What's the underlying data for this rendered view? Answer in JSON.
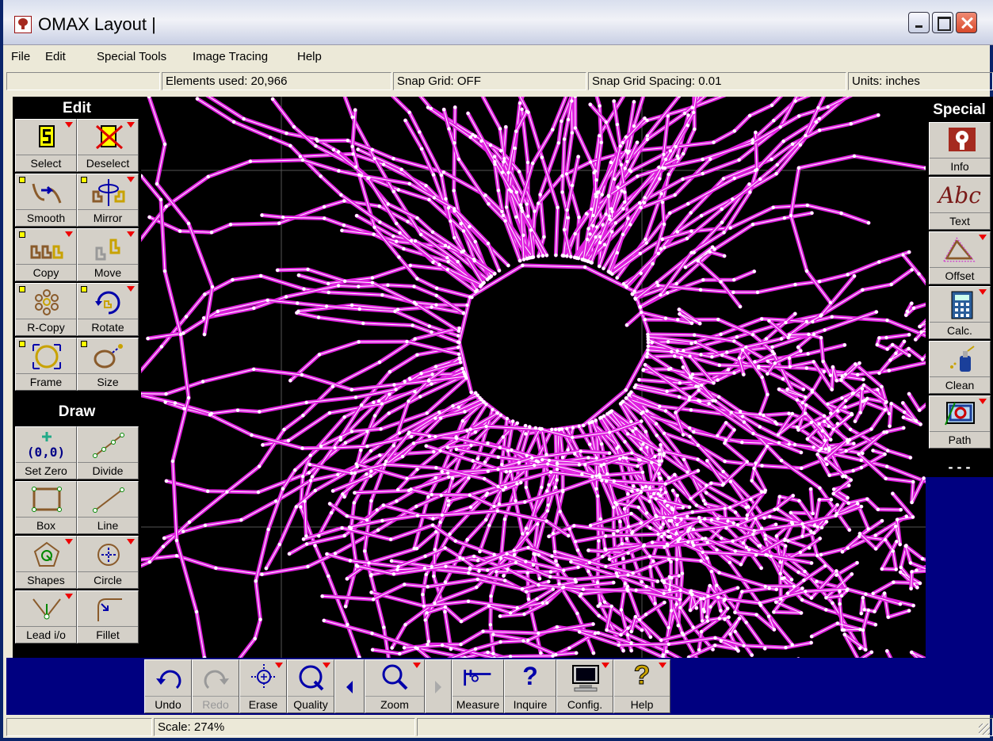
{
  "window": {
    "title": "OMAX Layout |"
  },
  "menu": [
    "File",
    "Edit",
    "Special Tools",
    "Image Tracing",
    "Help"
  ],
  "infobar": {
    "elements": "Elements used: 20,966",
    "snap_grid": "Snap Grid: OFF",
    "snap_spacing": "Snap Grid Spacing: 0.01",
    "units": "Units: inches"
  },
  "left_panel": {
    "edit_header": "Edit",
    "edit_buttons": [
      "Select",
      "Deselect",
      "Smooth",
      "Mirror",
      "Copy",
      "Move",
      "R-Copy",
      "Rotate",
      "Frame",
      "Size"
    ],
    "draw_header": "Draw",
    "draw_buttons": [
      "Set Zero",
      "Divide",
      "Box",
      "Line",
      "Shapes",
      "Circle",
      "Lead i/o",
      "Fillet"
    ],
    "set_zero_glyph": "(0,0)"
  },
  "right_panel": {
    "header": "Special",
    "buttons": [
      "Info",
      "Text",
      "Offset",
      "Calc.",
      "Clean",
      "Path"
    ],
    "text_glyph": "Abc",
    "more": "- - -"
  },
  "bottom_toolbar": [
    "Undo",
    "Redo",
    "Erase",
    "Quality",
    "Zoom",
    "Measure",
    "Inquire",
    "Config.",
    "Help"
  ],
  "status": {
    "scale": "Scale: 274%"
  },
  "colors": {
    "path": "#e020e0",
    "node": "#ffffff",
    "canvas": "#000000",
    "panel": "#000080"
  }
}
